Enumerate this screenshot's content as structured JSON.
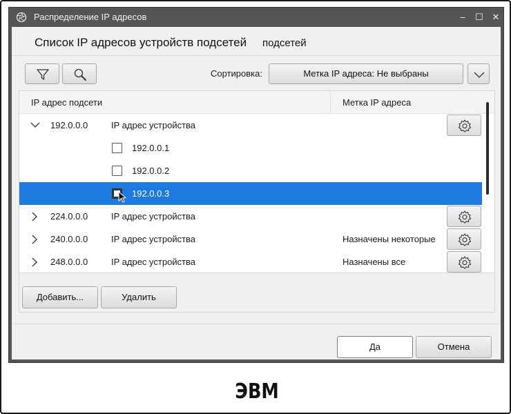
{
  "window": {
    "title": "Распределение IP адресов",
    "app_icon": "aperture-icon",
    "controls": {
      "minimize": "–",
      "maximize": "☐",
      "close": "✕"
    }
  },
  "header": {
    "title": "Список IP адресов устройств подсетей",
    "title_tail": "подсетей"
  },
  "toolbar": {
    "filter_icon": "filter-icon",
    "search_icon": "search-icon",
    "sort_label": "Сортировка:",
    "sort_value": "Метка IP адреса: Не выбраны",
    "sort_arrow_icon": "chevron-down-icon"
  },
  "grid": {
    "columns": [
      "IP адрес подсети",
      "Метка IP адреса"
    ],
    "rows": [
      {
        "ip": "192.0.0.0",
        "device": "IP адрес устройства",
        "tag": "",
        "expanded": true
      },
      {
        "ip": "224.0.0.0",
        "device": "IP адрес устройства",
        "tag": "",
        "expanded": false
      },
      {
        "ip": "240.0.0.0",
        "device": "IP адрес устройства",
        "tag": "Назначены некоторые",
        "expanded": false
      },
      {
        "ip": "248.0.0.0",
        "device": "IP адрес устройства",
        "tag": "Назначены все",
        "expanded": false
      }
    ],
    "children": [
      {
        "ip": "192.0.0.1",
        "checked": false,
        "selected": false
      },
      {
        "ip": "192.0.0.2",
        "checked": false,
        "selected": false
      },
      {
        "ip": "192.0.0.3",
        "checked": false,
        "selected": true
      }
    ],
    "selection_color": "#1f7ae0"
  },
  "actions": {
    "add": "Добавить...",
    "delete": "Удалить"
  },
  "footer": {
    "ok": "Да",
    "cancel": "Отмена"
  },
  "caption": "ЭВМ"
}
